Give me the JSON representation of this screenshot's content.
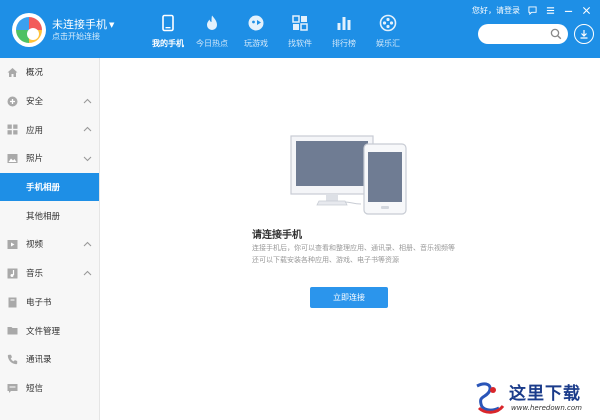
{
  "header": {
    "device_title": "未连接手机",
    "device_subtitle": "点击开始连接",
    "greeting": "您好，请登录",
    "search_placeholder": "",
    "nav": [
      {
        "label": "我的手机",
        "icon": "phone-icon",
        "active": true
      },
      {
        "label": "今日热点",
        "icon": "flame-icon",
        "active": false
      },
      {
        "label": "玩游戏",
        "icon": "gamepad-icon",
        "active": false
      },
      {
        "label": "找软件",
        "icon": "apps-grid-icon",
        "active": false
      },
      {
        "label": "排行榜",
        "icon": "bar-chart-icon",
        "active": false
      },
      {
        "label": "娱乐汇",
        "icon": "film-reel-icon",
        "active": false
      }
    ]
  },
  "sidebar": {
    "items": [
      {
        "label": "概况",
        "icon": "home-icon"
      },
      {
        "label": "安全",
        "icon": "shield-plus-icon",
        "chevron": "up"
      },
      {
        "label": "应用",
        "icon": "grid-icon",
        "chevron": "up"
      },
      {
        "label": "照片",
        "icon": "image-icon",
        "chevron": "down"
      },
      {
        "label": "手机相册",
        "sub": true,
        "selected": true
      },
      {
        "label": "其他相册",
        "sub": true
      },
      {
        "label": "视频",
        "icon": "play-icon",
        "chevron": "up"
      },
      {
        "label": "音乐",
        "icon": "music-note-icon",
        "chevron": "up"
      },
      {
        "label": "电子书",
        "icon": "book-icon"
      },
      {
        "label": "文件管理",
        "icon": "folder-icon"
      },
      {
        "label": "通讯录",
        "icon": "phone-handset-icon"
      },
      {
        "label": "短信",
        "icon": "message-icon"
      }
    ]
  },
  "main": {
    "title": "请连接手机",
    "desc_line1": "连接手机后，你可以查看和整理应用、通讯录、相册、音乐视频等",
    "desc_line2": "还可以下载安装各种应用、游戏、电子书等资源",
    "connect_button": "立即连接"
  },
  "watermark": {
    "text": "这里下载",
    "url": "www.heredown.com"
  },
  "colors": {
    "brand_blue": "#1e8fe6",
    "button_blue": "#2b95ec",
    "sidebar_bg": "#f7f7f7"
  }
}
